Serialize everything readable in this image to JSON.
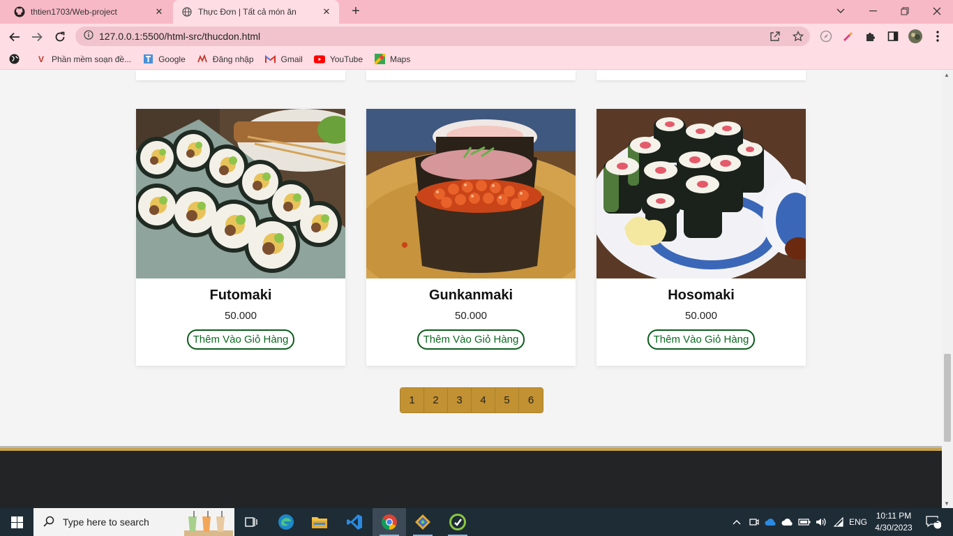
{
  "browser": {
    "tabs": [
      {
        "title": "thtien1703/Web-project",
        "icon": "github-icon",
        "active": false
      },
      {
        "title": "Thực Đơn | Tất cả món ăn",
        "icon": "globe-icon",
        "active": true
      }
    ],
    "url": "127.0.0.1:5500/html-src/thucdon.html",
    "bookmarks": [
      {
        "label": "Phần mềm soạn đề...",
        "icon": "v-logo-icon"
      },
      {
        "label": "Google",
        "icon": "google-icon"
      },
      {
        "label": "Đăng nhập",
        "icon": "login-icon"
      },
      {
        "label": "Gmail",
        "icon": "gmail-icon"
      },
      {
        "label": "YouTube",
        "icon": "youtube-icon"
      },
      {
        "label": "Maps",
        "icon": "maps-icon"
      }
    ]
  },
  "menu": {
    "items": [
      {
        "name": "Futomaki",
        "price": "50.000",
        "button": "Thêm Vào Giỏ Hàng",
        "image": "futomaki-photo"
      },
      {
        "name": "Gunkanmaki",
        "price": "50.000",
        "button": "Thêm Vào Giỏ Hàng",
        "image": "gunkanmaki-photo"
      },
      {
        "name": "Hosomaki",
        "price": "50.000",
        "button": "Thêm Vào Giỏ Hàng",
        "image": "hosomaki-photo"
      }
    ],
    "pages": [
      "1",
      "2",
      "3",
      "4",
      "5",
      "6"
    ],
    "colors": {
      "accent": "#c29132",
      "button_border": "#0a5c1a",
      "footer": "#222426"
    }
  },
  "taskbar": {
    "search_placeholder": "Type here to search",
    "language": "ENG",
    "time": "10:11 PM",
    "date": "4/30/2023",
    "notification_count": "2"
  }
}
